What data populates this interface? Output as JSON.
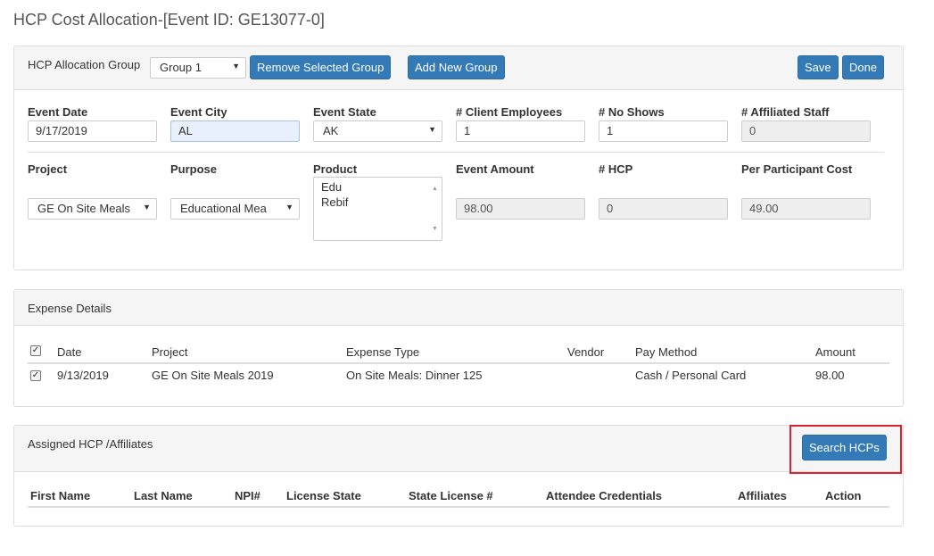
{
  "page_title": "HCP Cost Allocation-[Event ID: GE13077-0]",
  "allocation": {
    "group_label": "HCP Allocation Group",
    "group_value": "Group 1",
    "remove_group_label": "Remove Selected Group",
    "add_group_label": "Add New Group",
    "save_label": "Save",
    "done_label": "Done"
  },
  "fields": {
    "event_date": {
      "label": "Event Date",
      "value": "9/17/2019"
    },
    "event_city": {
      "label": "Event City",
      "value": "AL"
    },
    "event_state": {
      "label": "Event State",
      "value": "AK"
    },
    "client_employees": {
      "label": "# Client Employees",
      "value": "1"
    },
    "no_shows": {
      "label": "# No Shows",
      "value": "1"
    },
    "affiliated_staff": {
      "label": "# Affiliated Staff",
      "value": "0"
    },
    "project": {
      "label": "Project",
      "value": "GE On Site Meals"
    },
    "purpose": {
      "label": "Purpose",
      "value": "Educational Mea"
    },
    "product": {
      "label": "Product",
      "options": [
        "Edu",
        "Rebif"
      ]
    },
    "event_amount": {
      "label": "Event Amount",
      "value": "98.00"
    },
    "hcp_count": {
      "label": "# HCP",
      "value": "0"
    },
    "per_participant": {
      "label": "Per Participant Cost",
      "value": "49.00"
    }
  },
  "expense": {
    "title": "Expense Details",
    "columns": [
      "Date",
      "Project",
      "Expense Type",
      "Vendor",
      "Pay Method",
      "Amount"
    ],
    "rows": [
      {
        "date": "9/13/2019",
        "project": "GE On Site Meals 2019",
        "expense_type": "On Site Meals: Dinner 125",
        "vendor": "",
        "pay_method": "Cash / Personal Card",
        "amount": "98.00"
      }
    ]
  },
  "hcp": {
    "title": "Assigned HCP /Affiliates",
    "search_label": "Search HCPs",
    "columns": [
      "First Name",
      "Last Name",
      "NPI#",
      "License State",
      "State License #",
      "Attendee Credentials",
      "Affiliates",
      "Action"
    ]
  },
  "colors": {
    "primary": "#337ab7",
    "highlight": "#d9232e"
  },
  "icons": {
    "dropdown": "caret-down-icon",
    "check": "checkmark-icon"
  }
}
